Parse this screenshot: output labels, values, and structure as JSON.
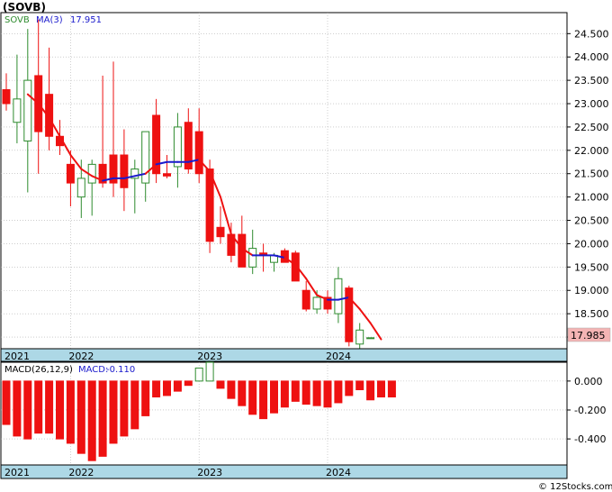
{
  "title": "(SOVB)",
  "watermark": "© 12Stocks.com",
  "colors": {
    "up": "#2e8b2e",
    "down": "#ee1111",
    "ma": "#ee1111",
    "ma_flat": "#1a1acc",
    "band": "#add8e6",
    "grid": "#b0b0b0",
    "price_box": "#f4b4b4"
  },
  "price_panel": {
    "legend_symbol": "SOVB",
    "legend_ma": "MA(3)",
    "legend_ma_value": "17.951",
    "last_price": "17.985",
    "y_ticks": [
      "24.500",
      "24.000",
      "23.500",
      "23.000",
      "22.500",
      "22.000",
      "21.500",
      "21.000",
      "20.500",
      "20.000",
      "19.500",
      "19.000",
      "18.500",
      "18.000"
    ]
  },
  "macd_panel": {
    "legend_label": "MACD(26,12,9)",
    "legend_value_label": "MACD:",
    "legend_value": "-0.110",
    "y_ticks": [
      "0.000",
      "-0.200",
      "-0.400"
    ]
  },
  "x_labels": [
    "2021",
    "2022",
    "2023",
    "2024"
  ],
  "chart_data": [
    {
      "type": "candlestick",
      "title": "(SOVB)",
      "ylim": [
        17.75,
        24.95
      ],
      "x_axis_labels": [
        "2021",
        "2022",
        "2023",
        "2024"
      ],
      "x_label_index": [
        0,
        6,
        18,
        30
      ],
      "series": [
        {
          "name": "SOVB",
          "ohlc": [
            [
              23.3,
              23.65,
              22.85,
              23.0
            ],
            [
              22.6,
              24.05,
              22.15,
              23.1
            ],
            [
              22.2,
              24.6,
              21.1,
              23.5
            ],
            [
              23.6,
              24.8,
              21.5,
              22.4
            ],
            [
              23.2,
              24.2,
              22.0,
              22.3
            ],
            [
              22.3,
              22.65,
              21.9,
              22.1
            ],
            [
              21.7,
              22.0,
              20.8,
              21.3
            ],
            [
              21.0,
              21.8,
              20.55,
              21.4
            ],
            [
              21.3,
              21.8,
              20.6,
              21.7
            ],
            [
              21.7,
              23.6,
              21.2,
              21.3
            ],
            [
              21.9,
              23.9,
              21.0,
              21.3
            ],
            [
              21.9,
              22.45,
              20.7,
              21.2
            ],
            [
              21.4,
              21.8,
              20.65,
              21.6
            ],
            [
              21.3,
              21.9,
              20.9,
              22.4
            ],
            [
              22.75,
              23.1,
              21.3,
              21.5
            ],
            [
              21.5,
              21.9,
              21.4,
              21.45
            ],
            [
              21.65,
              22.8,
              21.2,
              22.5
            ],
            [
              22.6,
              22.9,
              21.5,
              21.6
            ],
            [
              22.4,
              22.9,
              21.3,
              21.5
            ],
            [
              21.6,
              21.8,
              19.8,
              20.05
            ],
            [
              20.35,
              20.8,
              20.0,
              20.15
            ],
            [
              20.2,
              20.45,
              19.6,
              19.75
            ],
            [
              20.2,
              20.6,
              19.5,
              19.5
            ],
            [
              19.5,
              20.3,
              19.35,
              19.9
            ],
            [
              19.8,
              20.0,
              19.4,
              19.75
            ],
            [
              19.6,
              19.8,
              19.4,
              19.75
            ],
            [
              19.85,
              19.9,
              19.6,
              19.6
            ],
            [
              19.8,
              19.85,
              19.2,
              19.2
            ],
            [
              19.0,
              19.2,
              18.55,
              18.6
            ],
            [
              18.6,
              19.0,
              18.5,
              18.85
            ],
            [
              18.85,
              19.0,
              18.5,
              18.6
            ],
            [
              18.5,
              19.5,
              18.3,
              19.25
            ],
            [
              19.05,
              19.1,
              17.8,
              17.9
            ],
            [
              17.85,
              18.3,
              17.7,
              18.15
            ],
            [
              17.985,
              17.985,
              17.985,
              17.985
            ]
          ]
        },
        {
          "name": "MA(3)",
          "values": [
            null,
            null,
            23.2,
            23.0,
            22.7,
            22.3,
            21.9,
            21.6,
            21.45,
            21.35,
            21.4,
            21.4,
            21.45,
            21.5,
            21.7,
            21.75,
            21.75,
            21.75,
            21.8,
            21.55,
            21.0,
            20.2,
            19.9,
            19.75,
            19.75,
            19.75,
            19.7,
            19.55,
            19.25,
            18.9,
            18.8,
            18.8,
            18.85,
            18.6,
            18.3,
            17.951
          ]
        }
      ]
    },
    {
      "type": "bar",
      "title": "MACD(26,12,9)",
      "ylim": [
        -0.58,
        0.13
      ],
      "x_axis_labels": [
        "2021",
        "2022",
        "2023",
        "2024"
      ],
      "series": [
        {
          "name": "MACD",
          "values": [
            -0.3,
            -0.38,
            -0.4,
            -0.36,
            -0.36,
            -0.4,
            -0.43,
            -0.5,
            -0.55,
            -0.52,
            -0.43,
            -0.38,
            -0.33,
            -0.24,
            -0.11,
            -0.1,
            -0.07,
            -0.03,
            0.09,
            0.13,
            -0.05,
            -0.12,
            -0.17,
            -0.23,
            -0.26,
            -0.22,
            -0.18,
            -0.14,
            -0.16,
            -0.17,
            -0.18,
            -0.15,
            -0.1,
            -0.06,
            -0.13,
            -0.11,
            -0.11
          ]
        }
      ]
    }
  ]
}
